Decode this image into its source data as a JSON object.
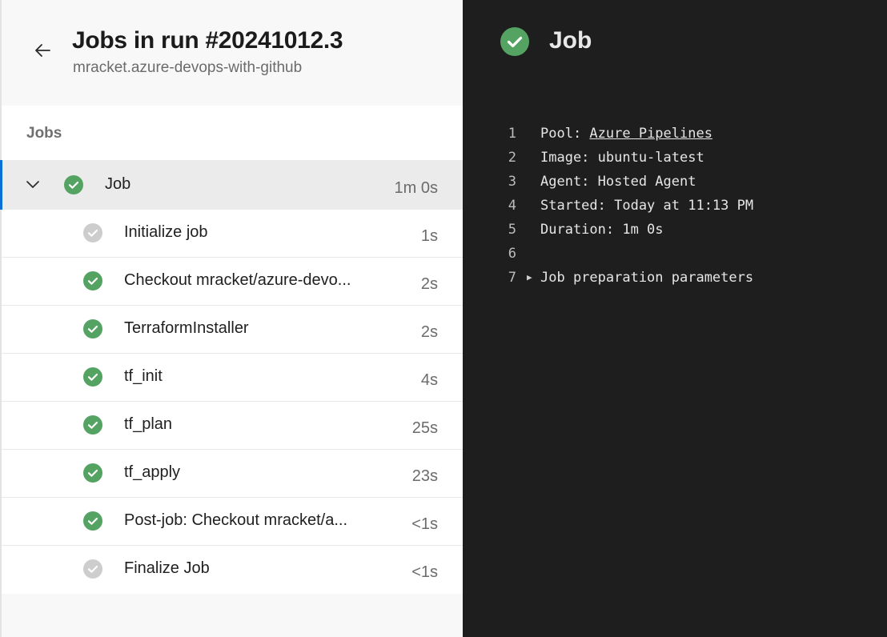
{
  "header": {
    "title": "Jobs in run #20241012.3",
    "subtitle": "mracket.azure-devops-with-github"
  },
  "jobs_panel": {
    "heading": "Jobs",
    "job": {
      "name": "Job",
      "duration": "1m 0s",
      "status": "success",
      "expanded": true
    },
    "steps": [
      {
        "name": "Initialize job",
        "duration": "1s",
        "status": "neutral"
      },
      {
        "name": "Checkout mracket/azure-devo...",
        "duration": "2s",
        "status": "success"
      },
      {
        "name": "TerraformInstaller",
        "duration": "2s",
        "status": "success"
      },
      {
        "name": "tf_init",
        "duration": "4s",
        "status": "success"
      },
      {
        "name": "tf_plan",
        "duration": "25s",
        "status": "success"
      },
      {
        "name": "tf_apply",
        "duration": "23s",
        "status": "success"
      },
      {
        "name": "Post-job: Checkout mracket/a...",
        "duration": "<1s",
        "status": "success"
      },
      {
        "name": "Finalize Job",
        "duration": "<1s",
        "status": "neutral"
      }
    ]
  },
  "detail": {
    "title": "Job",
    "log": [
      {
        "n": "1",
        "label": "Pool: ",
        "link": "Azure Pipelines"
      },
      {
        "n": "2",
        "text": "Image: ubuntu-latest"
      },
      {
        "n": "3",
        "text": "Agent: Hosted Agent"
      },
      {
        "n": "4",
        "text": "Started: Today at 11:13 PM"
      },
      {
        "n": "5",
        "text": "Duration: 1m 0s"
      },
      {
        "n": "6",
        "text": ""
      },
      {
        "n": "7",
        "text": "Job preparation parameters",
        "collapsible": true
      }
    ]
  },
  "colors": {
    "success": "#55a362",
    "neutral": "#cdcdcd",
    "accent": "#0a6fd6",
    "log_bg": "#1e1e1e"
  },
  "icons": {
    "back": "arrow-left-icon",
    "expand": "chevron-down-icon",
    "success": "check-circle-icon",
    "neutral": "check-circle-neutral-icon",
    "collapsible": "triangle-right-icon"
  }
}
